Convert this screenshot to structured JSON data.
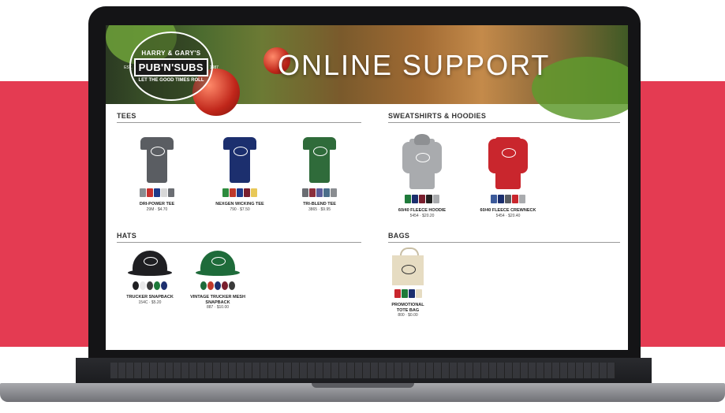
{
  "banner": {
    "logo_top": "HARRY & GARY'S",
    "logo_main": "PUB'N'SUBS",
    "logo_side_left": "EST.",
    "logo_side_right": "1987",
    "logo_bottom": "LET THE GOOD TIMES ROLL",
    "title": "ONLINE SUPPORT"
  },
  "sections": {
    "tees": {
      "title": "TEES",
      "products": [
        {
          "name": "DRI-POWER TEE",
          "price": "29M · $4.70",
          "color": "#5a5d62",
          "swatches": [
            "#8a8d91",
            "#c8302e",
            "#1f3a8a",
            "#d8d8d8",
            "#6b6e73"
          ]
        },
        {
          "name": "NEXGEN WICKING TEE",
          "price": "790 · $7.50",
          "color": "#1c2f6e",
          "swatches": [
            "#2e8b3e",
            "#c0392b",
            "#1f3a8a",
            "#7a1f2e",
            "#e8c858"
          ]
        },
        {
          "name": "TRI-BLEND TEE",
          "price": "3865 · $9.95",
          "color": "#2f6b3a",
          "swatches": [
            "#6b6e73",
            "#8b2e3c",
            "#5a5d9a",
            "#4b6e8a",
            "#8a8d91"
          ]
        }
      ]
    },
    "sweatshirts": {
      "title": "SWEATSHIRTS & HOODIES",
      "products": [
        {
          "name": "60/40 FLEECE HOODIE",
          "price": "5454 · $20.20",
          "color": "#a9abae",
          "swatches": [
            "#1e7a3a",
            "#1c2f6e",
            "#7a1f2e",
            "#222",
            "#a9abae"
          ]
        },
        {
          "name": "60/40 FLEECE CREWNECK",
          "price": "5454 · $20.40",
          "color": "#c9262d",
          "swatches": [
            "#3c5a9a",
            "#1c2f6e",
            "#5a5d62",
            "#c9262d",
            "#a9abae"
          ]
        }
      ]
    },
    "hats": {
      "title": "HATS",
      "products": [
        {
          "name": "TRUCKER SNAPBACK",
          "price": "154C · $5.20",
          "color": "#1f1f22",
          "swatches": [
            "#1f1f22",
            "#e8e8e8",
            "#3a3a3a",
            "#1e7a3a",
            "#1c2f6e"
          ]
        },
        {
          "name": "VINTAGE TRUCKER MESH SNAPBACK",
          "price": "887 · $10.00",
          "color": "#1e6b3a",
          "swatches": [
            "#1e6b3a",
            "#c0392b",
            "#1c2f6e",
            "#7a1f2e",
            "#3a3a3a"
          ]
        }
      ]
    },
    "bags": {
      "title": "BAGS",
      "products": [
        {
          "name": "PROMOTIONAL TOTE BAG",
          "price": "800 · $0.00",
          "color": "#e6dcc2",
          "swatches": [
            "#c9262d",
            "#1e7a3a",
            "#1c2f6e",
            "#e6dcc2"
          ]
        }
      ]
    }
  }
}
